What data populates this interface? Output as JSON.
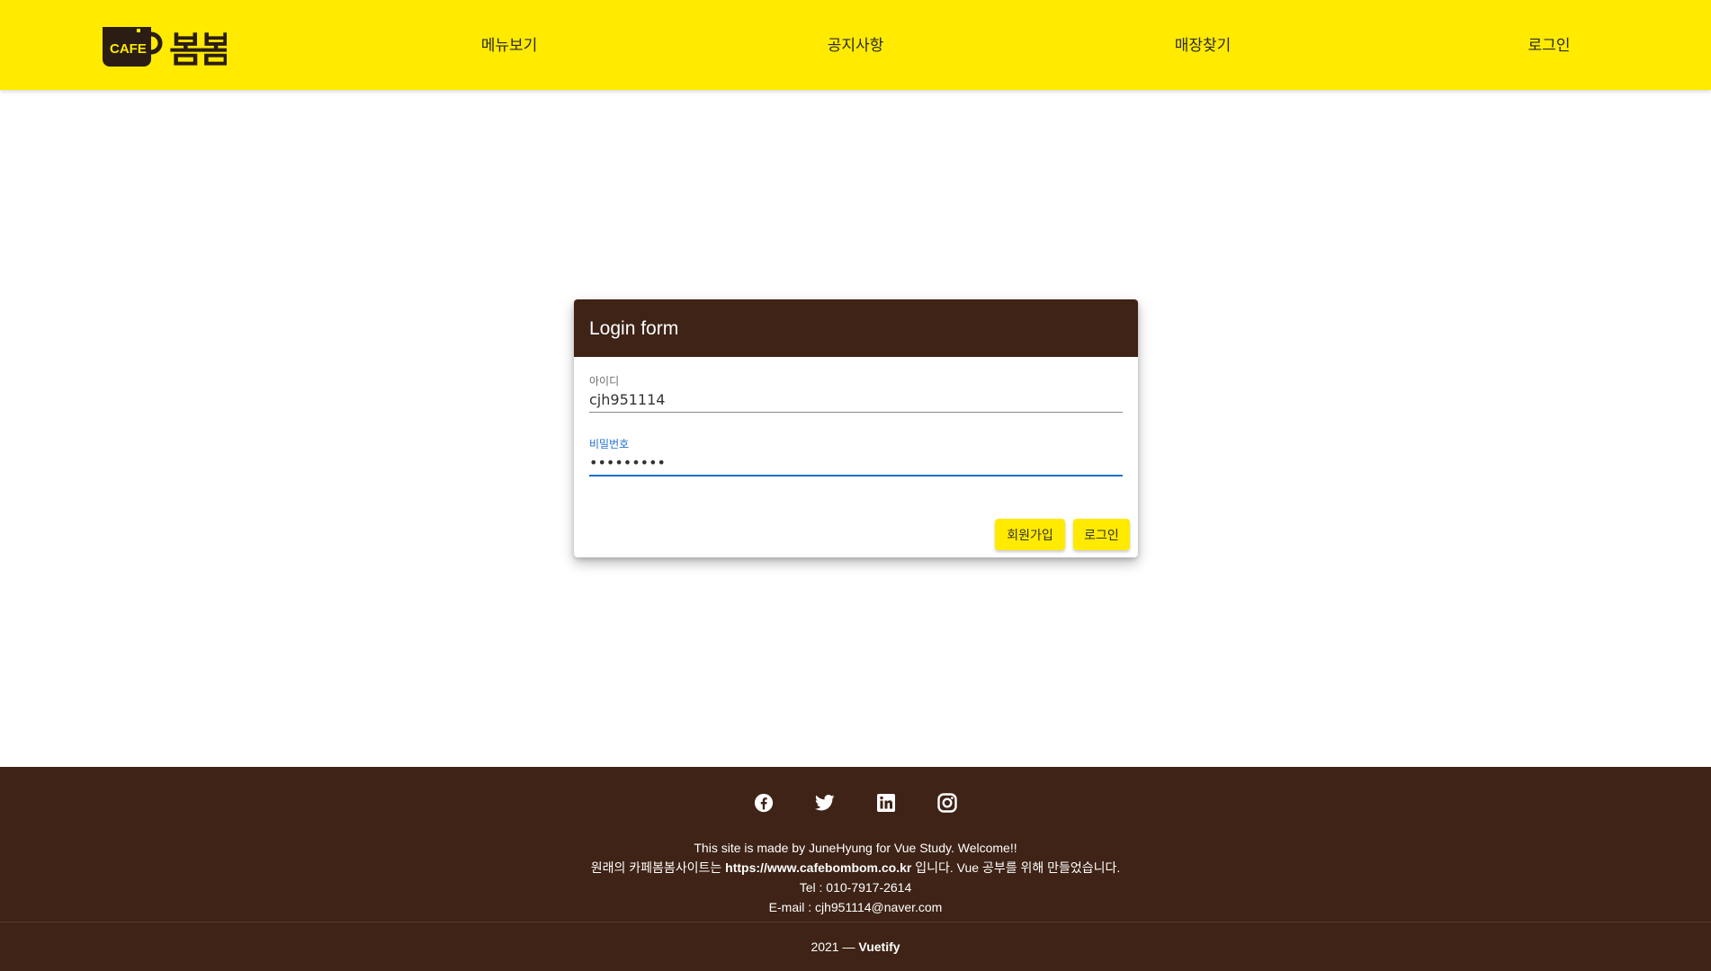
{
  "header": {
    "logo_cup_text": "CAFE",
    "logo_name": "봄봄",
    "nav": [
      "메뉴보기",
      "공지사항",
      "매장찾기",
      "로그인"
    ]
  },
  "login": {
    "title": "Login form",
    "id_label": "아이디",
    "id_value": "cjh951114",
    "pw_label": "비밀번호",
    "pw_value": "•••••••••",
    "signup_label": "회원가입",
    "login_label": "로그인"
  },
  "footer": {
    "social_icons": [
      "facebook-icon",
      "twitter-icon",
      "linkedin-icon",
      "instagram-icon"
    ],
    "line1": "This site is made by JuneHyung for Vue Study. Welcome!!",
    "line2_pre": "원래의 카페봄봄사이트는 ",
    "line2_url": "https://www.cafebombom.co.kr",
    "line2_post": " 입니다. Vue 공부를 위해 만들었습니다.",
    "tel": "Tel : 010-7917-2614",
    "email": "E-mail : cjh951114@naver.com",
    "copyright_year": "2021 — ",
    "copyright_brand": "Vuetify"
  },
  "colors": {
    "header_bg": "#ffea00",
    "brown": "#3e2316",
    "focus_blue": "#1f6fd1"
  }
}
